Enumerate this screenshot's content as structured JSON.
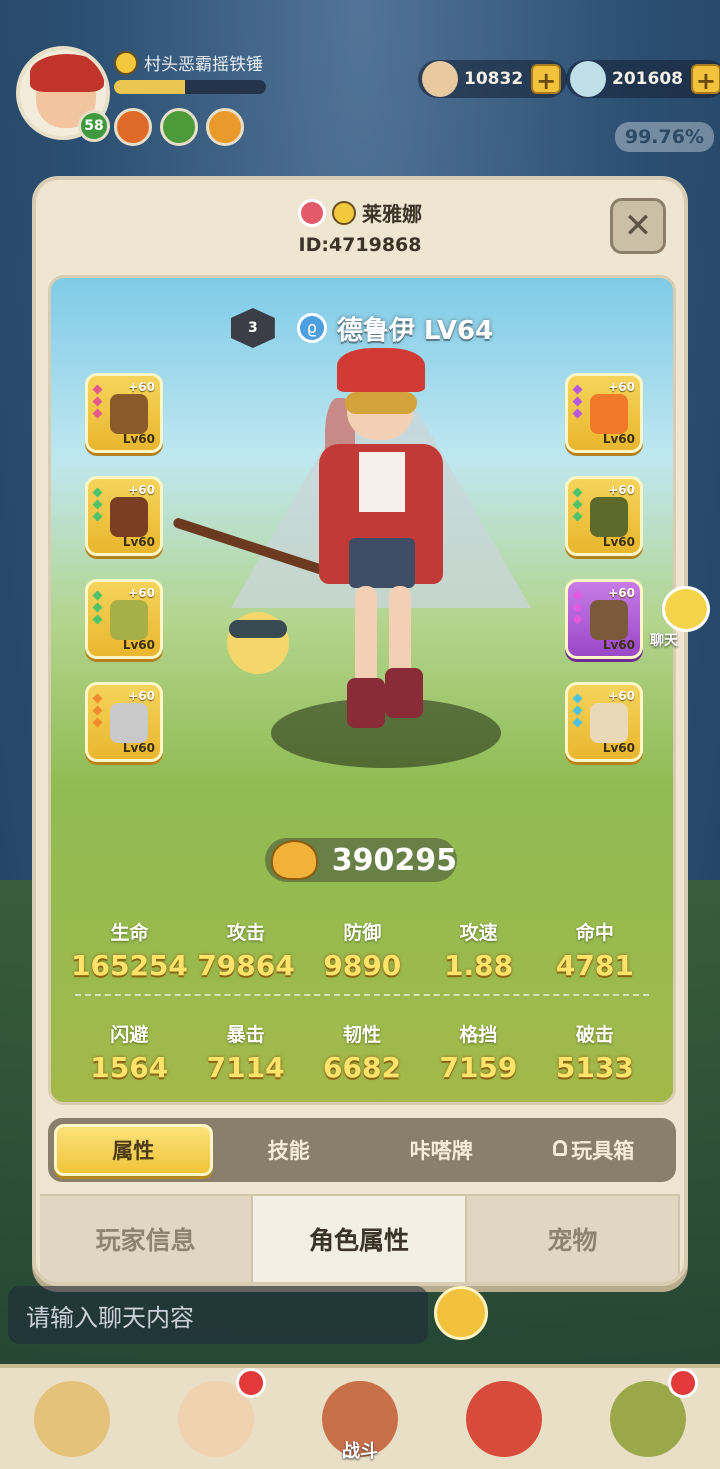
{
  "hud": {
    "player_name": "村头恶霸摇铁锤",
    "level": "58",
    "xp_fraction": 0.47,
    "currency_1": "10832",
    "currency_2": "201608",
    "progress_percent": "99.76%"
  },
  "profile": {
    "name": "莱雅娜",
    "id": "ID:4719868",
    "close_symbol": "✕",
    "rank": "3",
    "class_label": "德鲁伊 LV64",
    "power": "390295"
  },
  "equipment_left": [
    {
      "plus": "+60",
      "level": "Lv60",
      "color": "#8a5a2a"
    },
    {
      "plus": "+60",
      "level": "Lv60",
      "color": "#7a3f22"
    },
    {
      "plus": "+60",
      "level": "Lv60",
      "color": "#a6b046"
    },
    {
      "plus": "+60",
      "level": "Lv60",
      "color": "#c9c9c9"
    }
  ],
  "equipment_right": [
    {
      "plus": "+60",
      "level": "Lv60",
      "color": "#f07a2a"
    },
    {
      "plus": "+60",
      "level": "Lv60",
      "color": "#5d6a2a"
    },
    {
      "plus": "+60",
      "level": "Lv60",
      "color": "#7a5a3a"
    },
    {
      "plus": "+60",
      "level": "Lv60",
      "color": "#e9d9b6"
    }
  ],
  "stats_row1": [
    {
      "label": "生命",
      "value": "165254"
    },
    {
      "label": "攻击",
      "value": "79864"
    },
    {
      "label": "防御",
      "value": "9890"
    },
    {
      "label": "攻速",
      "value": "1.88"
    },
    {
      "label": "命中",
      "value": "4781"
    }
  ],
  "stats_row2": [
    {
      "label": "闪避",
      "value": "1564"
    },
    {
      "label": "暴击",
      "value": "7114"
    },
    {
      "label": "韧性",
      "value": "6682"
    },
    {
      "label": "格挡",
      "value": "7159"
    },
    {
      "label": "破击",
      "value": "5133"
    }
  ],
  "sub_tabs": [
    "属性",
    "技能",
    "咔嗒牌",
    "玩具箱"
  ],
  "main_tabs": [
    "玩家信息",
    "角色属性",
    "宠物"
  ],
  "chat": {
    "float_label": "聊天",
    "input_placeholder": "请输入聊天内容"
  },
  "bottom_nav": {
    "battle_label": "战斗"
  },
  "colors": {
    "accent_gold": "#f0c43a",
    "stat_number": "#ffe36a"
  }
}
